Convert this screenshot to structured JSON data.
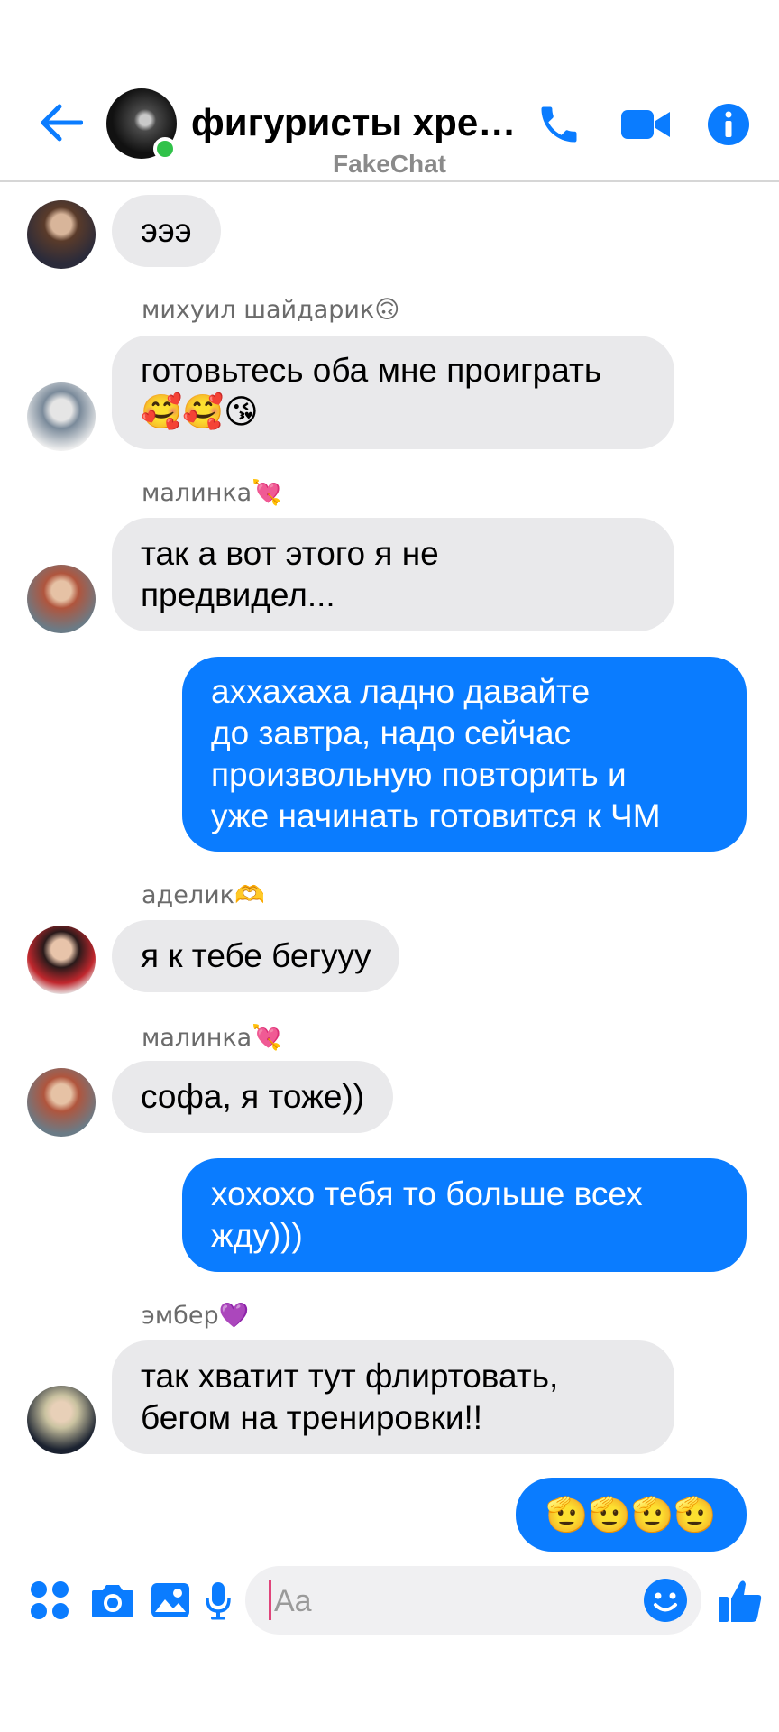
{
  "header": {
    "title": "фигуристы хрено...",
    "watermark": "FakeChat",
    "icons": [
      "back-arrow-icon",
      "phone-icon",
      "video-camera-icon",
      "info-icon"
    ],
    "accent_color": "#0a7cff",
    "online_color": "#31c24a"
  },
  "messages": [
    {
      "type": "incoming",
      "text": "эээ"
    },
    {
      "type": "incoming",
      "sender": "михуил шайдарик🙃",
      "text": "готовьтесь оба мне проиграть 🥰🥰😘"
    },
    {
      "type": "incoming",
      "sender": "малинка💘",
      "text_line1": "так а вот этого я не",
      "text_line2": "предвидел..."
    },
    {
      "type": "outgoing",
      "line1": "аххахаха ладно давайте",
      "line2": "до завтра, надо сейчас",
      "line3": "произвольную повторить и",
      "line4": "уже начинать готовится к ЧМ"
    },
    {
      "type": "incoming",
      "sender": "аделик🫶",
      "text": "я к тебе бегууу"
    },
    {
      "type": "incoming",
      "sender": "малинка💘",
      "text": "софа, я тоже))"
    },
    {
      "type": "outgoing",
      "line1": "хохохо тебя то больше всех",
      "line2": "жду)))"
    },
    {
      "type": "incoming",
      "sender": "эмбер💜",
      "text_line1": "так хватит тут флиртовать,",
      "text_line2": "бегом на тренировки!!"
    },
    {
      "type": "outgoing",
      "text": "🫡🫡🫡🫡"
    }
  ],
  "composer": {
    "placeholder": "Aa",
    "icons": [
      "apps-icon",
      "camera-icon",
      "gallery-icon",
      "microphone-icon",
      "emoji-icon",
      "thumbs-up-icon"
    ]
  },
  "colors": {
    "incoming_bubble": "#e9e9eb",
    "outgoing_bubble": "#0a7cff",
    "sender_name": "#6b6b6b"
  }
}
